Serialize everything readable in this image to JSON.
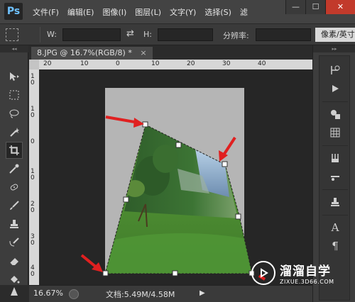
{
  "app": {
    "logo": "Ps",
    "menu": [
      "文件(F)",
      "编辑(E)",
      "图像(I)",
      "图层(L)",
      "文字(Y)",
      "选择(S)",
      "滤"
    ],
    "window_controls": [
      "—",
      "☐",
      "✕"
    ]
  },
  "options": {
    "w_label": "W:",
    "w_value": "",
    "h_label": "H:",
    "h_value": "",
    "resolution_label": "分辨率:",
    "resolution_value": "",
    "unit_dropdown": "像素/英寸"
  },
  "document": {
    "tab_title": "8.JPG @ 16.7%(RGB/8) *",
    "tab_close": "×",
    "ruler_h_labels": [
      "20",
      "10",
      "0",
      "10",
      "20",
      "30",
      "40"
    ],
    "ruler_v_labels": [
      "1\n0",
      "1\n0",
      "0",
      "1\n0",
      "2\n0",
      "3\n0",
      "4\n0",
      "5\n0"
    ]
  },
  "status": {
    "zoom": "16.67%",
    "doc_info": "文档:5.49M/4.58M",
    "arrow": "▶"
  },
  "watermark": {
    "title": "溜溜自学",
    "url": "ZIXUE.3D66.COM"
  },
  "tools": [
    "move-tool-icon",
    "marquee-tool-icon",
    "lasso-tool-icon",
    "magic-wand-tool-icon",
    "crop-tool-icon",
    "eyedropper-tool-icon",
    "healing-brush-tool-icon",
    "brush-tool-icon",
    "clone-stamp-tool-icon",
    "history-brush-tool-icon",
    "eraser-tool-icon",
    "paint-bucket-tool-icon",
    "blur-tool-icon"
  ],
  "colors": {
    "accent_blue": "#6fc2ff",
    "arrow_red": "#e02020",
    "close_red": "#c23a2b"
  }
}
